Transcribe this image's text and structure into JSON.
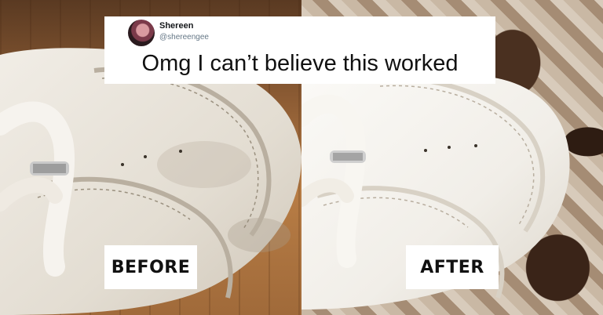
{
  "tweet": {
    "user_name": "Shereen",
    "user_handle": "@shereengee",
    "text": "Omg I can’t believe this worked"
  },
  "labels": {
    "before": "BEFORE",
    "after": "AFTER"
  },
  "colors": {
    "card_background": "#ffffff",
    "label_text": "#111111",
    "shoe_leather": "#ece7de"
  }
}
